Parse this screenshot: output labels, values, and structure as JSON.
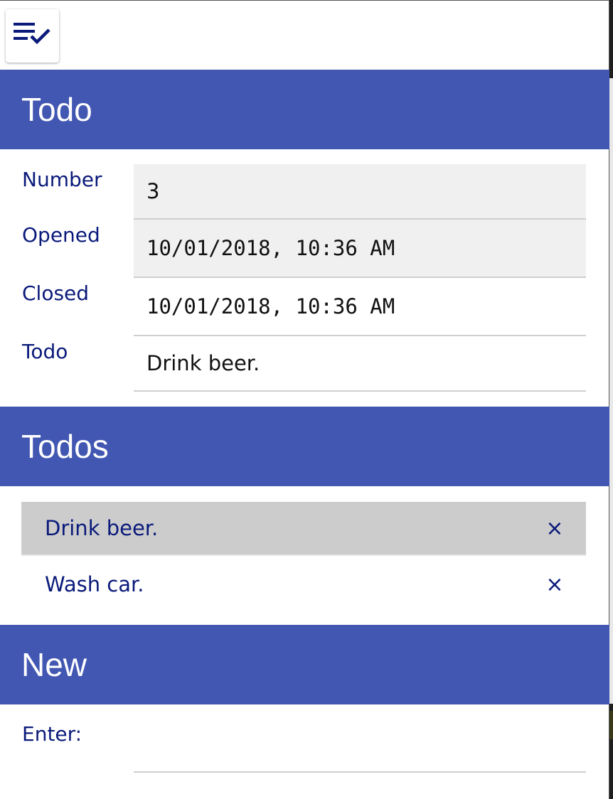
{
  "menu": {
    "icon": "playlist-check-icon"
  },
  "todo_section": {
    "title": "Todo",
    "fields": {
      "number": {
        "label": "Number",
        "value": "3"
      },
      "opened": {
        "label": "Opened",
        "value": "10/01/2018, 10:36 AM"
      },
      "closed": {
        "label": "Closed",
        "value": "10/01/2018, 10:36 AM"
      },
      "todo": {
        "label": "Todo",
        "value": "Drink beer."
      }
    }
  },
  "todos_section": {
    "title": "Todos",
    "items": [
      {
        "label": "Drink beer.",
        "remove": "×",
        "selected": true
      },
      {
        "label": "Wash car.",
        "remove": "×",
        "selected": false
      }
    ]
  },
  "new_section": {
    "title": "New",
    "enter_label": "Enter:",
    "input_value": ""
  },
  "colors": {
    "header_bg": "#4257b2",
    "header_text": "#ffffff",
    "label_text": "#0a1a7a",
    "readonly_bg": "#f0f0f0",
    "selected_bg": "#cccccc"
  }
}
